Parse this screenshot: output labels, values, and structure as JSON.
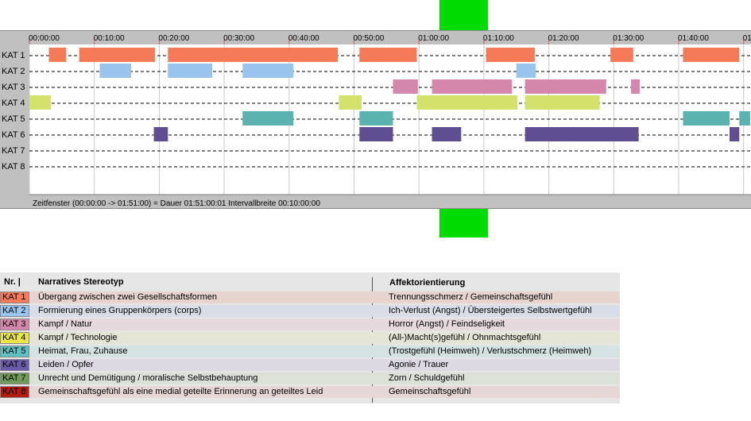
{
  "chart_data": {
    "type": "timeline",
    "title": "",
    "x_axis": {
      "unit": "hh:mm:ss",
      "range": [
        "00:00:00",
        "01:51:00"
      ],
      "tick_labels": [
        "00:00:00",
        "00:10:00",
        "00:20:00",
        "00:30:00",
        "00:40:00",
        "00:50:00",
        "01:00:00",
        "01:10:00",
        "01:20:00",
        "01:30:00",
        "01:40:00",
        "01"
      ]
    },
    "categories": [
      "KAT 1",
      "KAT 2",
      "KAT 3",
      "KAT 4",
      "KAT 5",
      "KAT 6",
      "KAT 7",
      "KAT 8"
    ],
    "category_colors": [
      "#f47a58",
      "#99c4ee",
      "#d587ab",
      "#d2e26a",
      "#5bb3b0",
      "#5f4e92",
      "#3d7a3c",
      "#a01e1e"
    ],
    "segments": [
      {
        "category": "KAT 1",
        "start": "00:03:00",
        "end": "00:05:40"
      },
      {
        "category": "KAT 1",
        "start": "00:07:40",
        "end": "00:19:20"
      },
      {
        "category": "KAT 1",
        "start": "00:21:20",
        "end": "00:47:30"
      },
      {
        "category": "KAT 1",
        "start": "00:50:50",
        "end": "00:59:40"
      },
      {
        "category": "KAT 1",
        "start": "01:10:20",
        "end": "01:17:50"
      },
      {
        "category": "KAT 1",
        "start": "01:29:30",
        "end": "01:33:00"
      },
      {
        "category": "KAT 1",
        "start": "01:40:40",
        "end": "01:49:20"
      },
      {
        "category": "KAT 2",
        "start": "00:10:50",
        "end": "00:15:40"
      },
      {
        "category": "KAT 2",
        "start": "00:21:20",
        "end": "00:28:10"
      },
      {
        "category": "KAT 2",
        "start": "00:32:50",
        "end": "00:40:40"
      },
      {
        "category": "KAT 2",
        "start": "01:15:00",
        "end": "01:18:00"
      },
      {
        "category": "KAT 3",
        "start": "00:56:00",
        "end": "00:59:50"
      },
      {
        "category": "KAT 3",
        "start": "01:02:00",
        "end": "01:14:20"
      },
      {
        "category": "KAT 3",
        "start": "01:16:20",
        "end": "01:28:50"
      },
      {
        "category": "KAT 3",
        "start": "01:32:40",
        "end": "01:34:00"
      },
      {
        "category": "KAT 4",
        "start": "00:00:00",
        "end": "00:03:20"
      },
      {
        "category": "KAT 4",
        "start": "00:47:40",
        "end": "00:51:10"
      },
      {
        "category": "KAT 4",
        "start": "00:59:40",
        "end": "01:15:10"
      },
      {
        "category": "KAT 4",
        "start": "01:16:20",
        "end": "01:27:50"
      },
      {
        "category": "KAT 5",
        "start": "00:32:50",
        "end": "00:40:40"
      },
      {
        "category": "KAT 5",
        "start": "00:50:50",
        "end": "00:56:00"
      },
      {
        "category": "KAT 5",
        "start": "01:40:40",
        "end": "01:47:50"
      },
      {
        "category": "KAT 5",
        "start": "01:49:20",
        "end": "01:51:00"
      },
      {
        "category": "KAT 6",
        "start": "00:19:10",
        "end": "00:21:20"
      },
      {
        "category": "KAT 6",
        "start": "00:50:50",
        "end": "00:56:00"
      },
      {
        "category": "KAT 6",
        "start": "01:02:00",
        "end": "01:06:30"
      },
      {
        "category": "KAT 6",
        "start": "01:16:20",
        "end": "01:33:50"
      },
      {
        "category": "KAT 6",
        "start": "01:47:50",
        "end": "01:49:20"
      }
    ],
    "status_text": "Zeitfenster (00:00:00 -> 01:51:00) = Dauer 01:51:00:01      Intervallbreite 00:10:00:00"
  },
  "legend": {
    "headers": {
      "nr": "Nr. |",
      "stereotype": "Narratives Stereotyp",
      "affect": "Affektorientierung"
    },
    "rows": [
      {
        "kat": "KAT 1",
        "stereotype": "Übergang zwischen zwei Gesellschaftsformen",
        "affect": "Trennungsschmerz / Gemeinschaftsgefühl",
        "color": "#f47a58",
        "row_bg": "#e8d4cf"
      },
      {
        "kat": "KAT 2",
        "stereotype": "Formierung eines Gruppenkörpers (corps)",
        "affect": "Ich-Verlust (Angst) / Übersteigertes Selbstwertgefühl",
        "color": "#99c4ee",
        "row_bg": "#d9dde8"
      },
      {
        "kat": "KAT 3",
        "stereotype": "Kampf / Natur",
        "affect": "Horror (Angst) / Feindseligkeit",
        "color": "#d587ab",
        "row_bg": "#e6d9de"
      },
      {
        "kat": "KAT 4",
        "stereotype": "Kampf / Technologie",
        "affect": "(All-)Macht(s)gefühl / Ohnmachtsgefühl",
        "color": "#eae64a",
        "row_bg": "#e4e5d4"
      },
      {
        "kat": "KAT 5",
        "stereotype": "Heimat, Frau, Zuhause",
        "affect": "(Trostgefühl (Heimweh) / Verlustschmerz (Heimweh)",
        "color": "#5fc0c0",
        "row_bg": "#d4e3e2"
      },
      {
        "kat": "KAT 6",
        "stereotype": "Leiden / Opfer",
        "affect": "Agonie / Trauer",
        "color": "#6a5aa8",
        "row_bg": "#dcd9e3"
      },
      {
        "kat": "KAT 7",
        "stereotype": "Unrecht und Demütigung / moralische Selbstbehauptung",
        "affect": "Zorn / Schuldgefühl",
        "color": "#6f9a58",
        "row_bg": "#dbe1d7"
      },
      {
        "kat": "KAT 8",
        "stereotype": "Gemeinschaftsgefühl als eine medial geteilte Erinnerung an geteiltes Leid",
        "affect": "Gemeinschaftsgefühl",
        "color": "#b01c10",
        "row_bg": "#e6d6d6"
      }
    ]
  }
}
